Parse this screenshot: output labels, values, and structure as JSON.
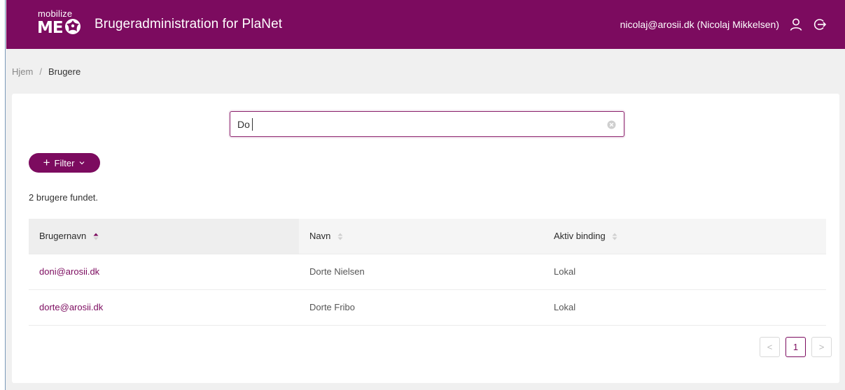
{
  "header": {
    "logo_small": "mobilize",
    "logo_large": "ME",
    "title": "Brugeradministration for PlaNet",
    "user": "nicolaj@arosii.dk (Nicolaj Mikkelsen)",
    "icons": [
      "user-icon",
      "logout-icon"
    ]
  },
  "breadcrumb": {
    "home": "Hjem",
    "separator": "/",
    "current": "Brugere"
  },
  "search": {
    "value": "Do",
    "placeholder": ""
  },
  "filter": {
    "label": "Filter",
    "plus": "+"
  },
  "results": {
    "count_text": "2 brugere fundet."
  },
  "table": {
    "columns": [
      "Brugernavn",
      "Navn",
      "Aktiv binding"
    ],
    "rows": [
      [
        "doni@arosii.dk",
        "Dorte Nielsen",
        "Lokal"
      ],
      [
        "dorte@arosii.dk",
        "Dorte Fribo",
        "Lokal"
      ]
    ]
  },
  "pagination": {
    "prev": "<",
    "current": "1",
    "next": ">"
  },
  "colors": {
    "brand": "#7c0b5f",
    "background": "#f0f0f0"
  }
}
